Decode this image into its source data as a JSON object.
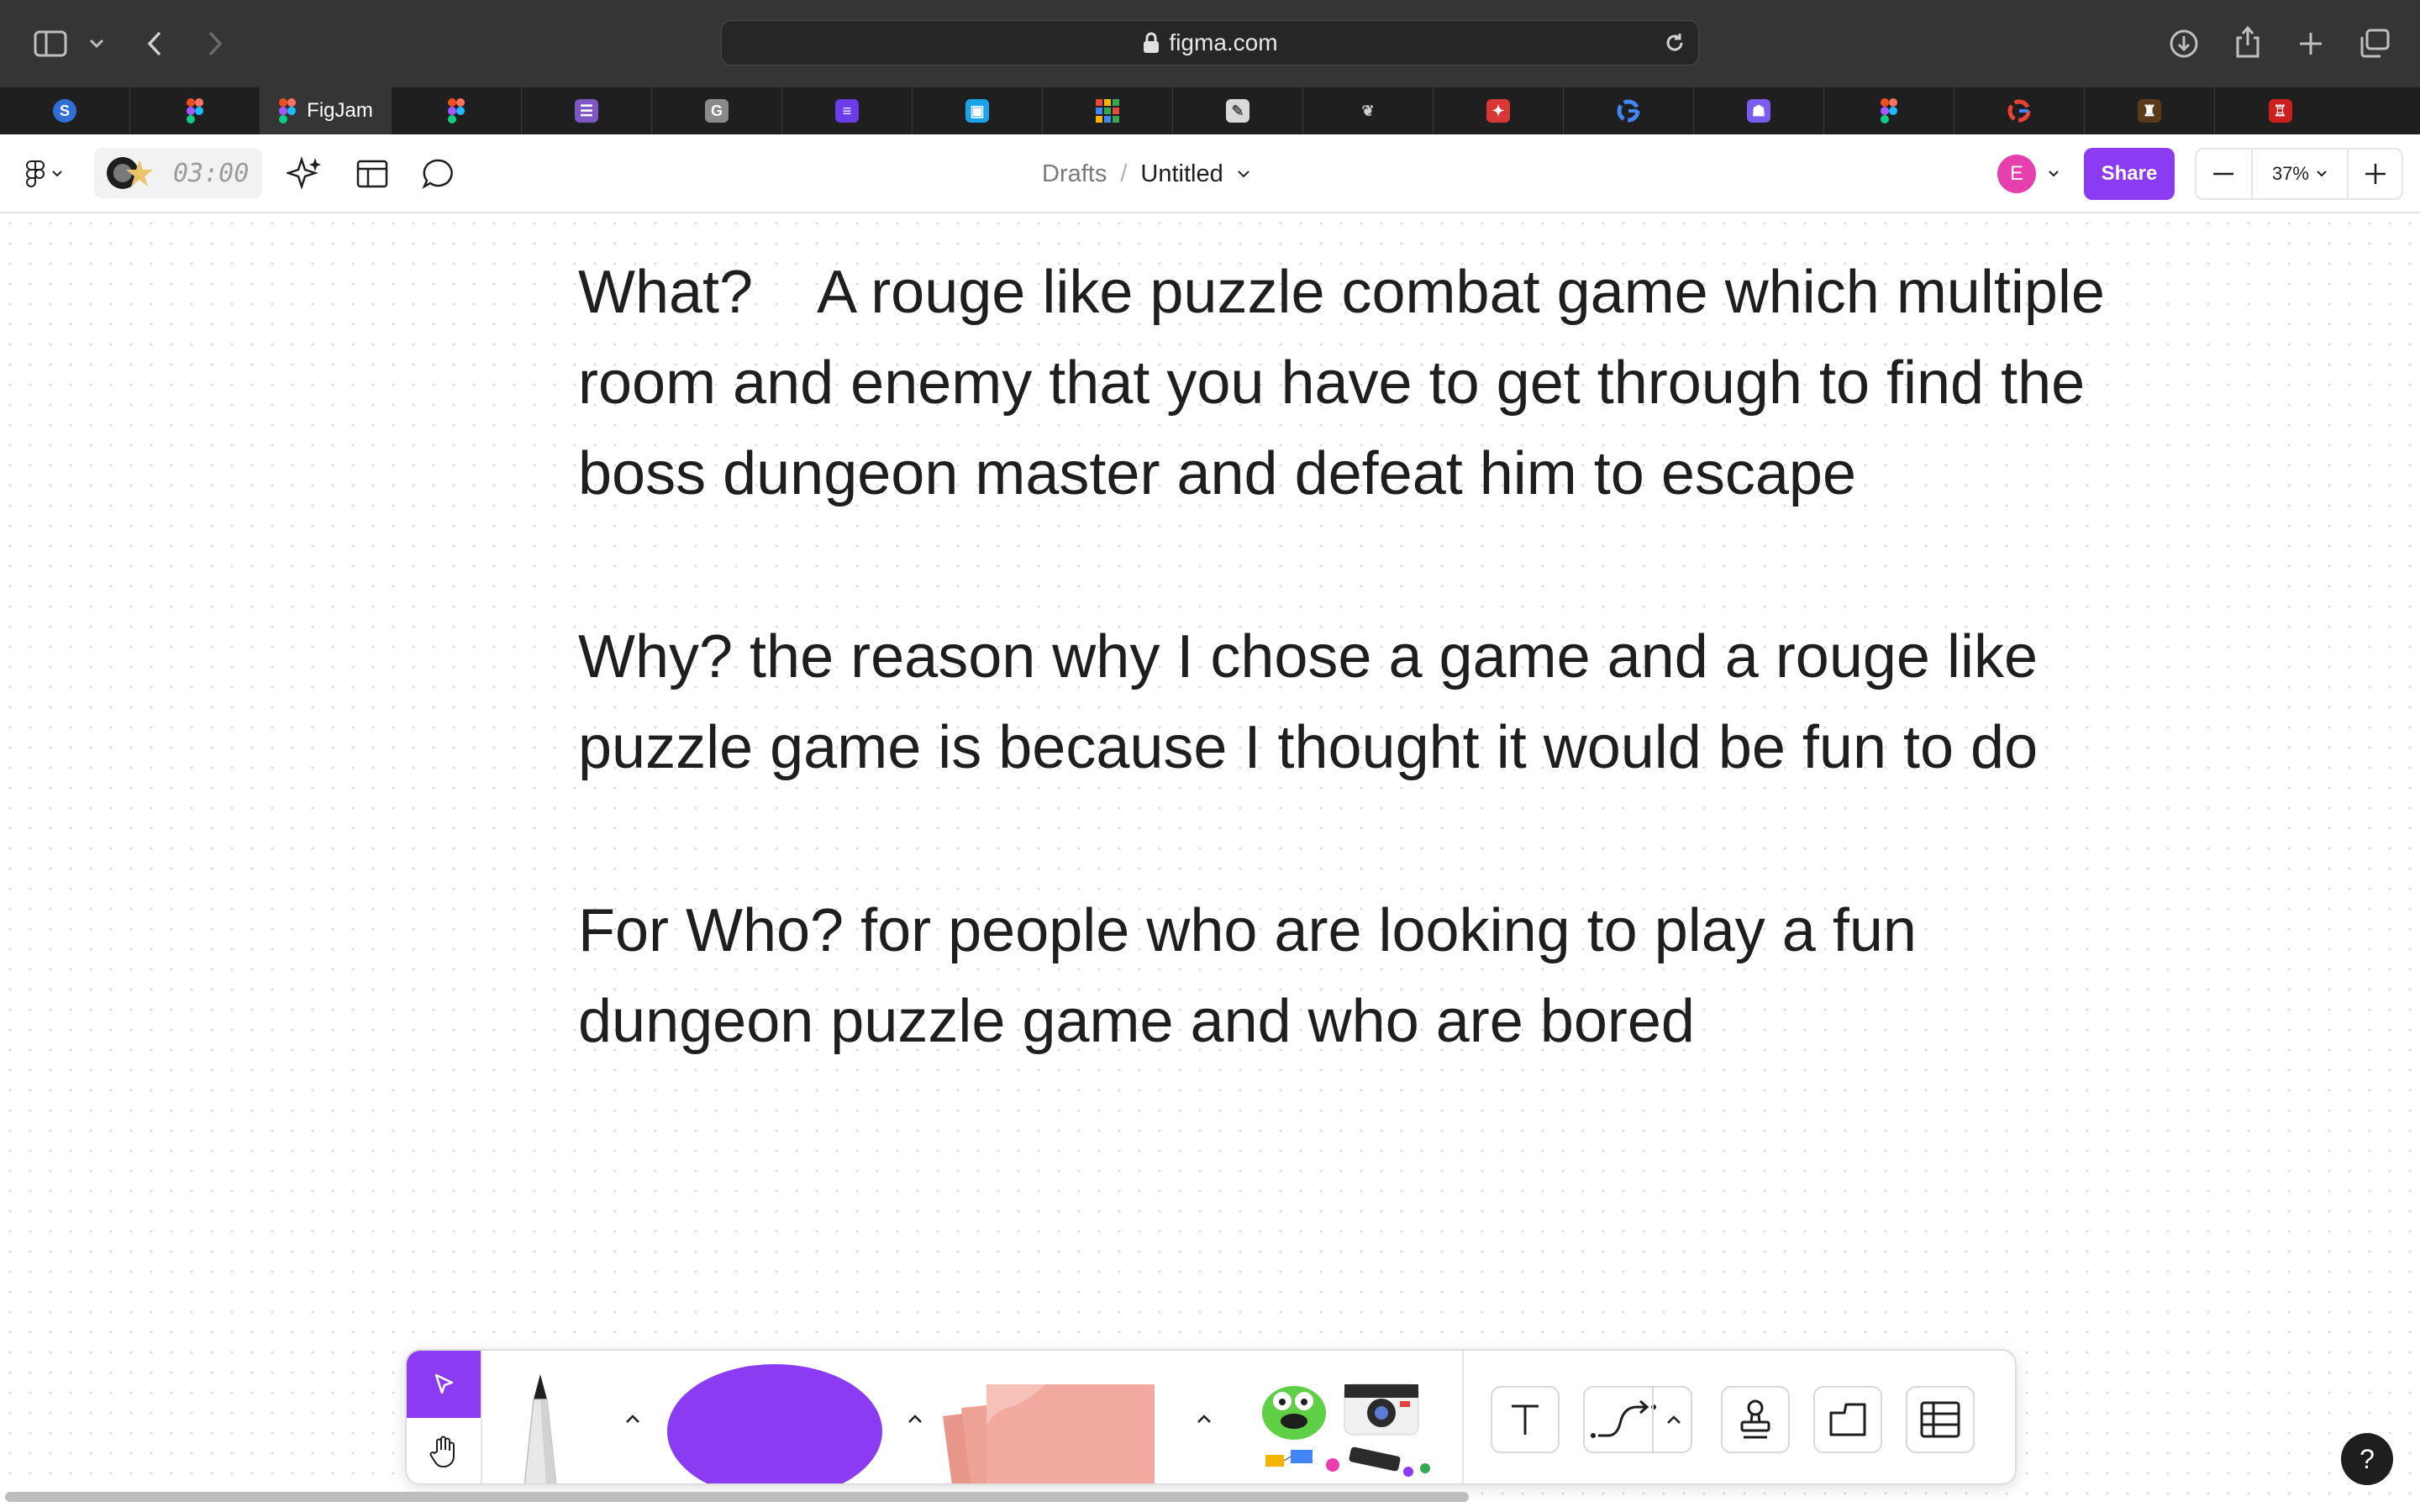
{
  "browser": {
    "url": "figma.com",
    "tabs": [
      {
        "label": "",
        "icon": "s-circle-icon"
      },
      {
        "label": "",
        "icon": "figma-icon"
      },
      {
        "label": "FigJam",
        "icon": "figma-icon",
        "active": true
      },
      {
        "label": "",
        "icon": "figma-icon"
      },
      {
        "label": "",
        "icon": "google-forms-icon"
      },
      {
        "label": "",
        "icon": "g-letter-icon"
      },
      {
        "label": "",
        "icon": "list-app-icon"
      },
      {
        "label": "",
        "icon": "square-app-icon"
      },
      {
        "label": "",
        "icon": "grid-app-icon"
      },
      {
        "label": "",
        "icon": "paper-app-icon"
      },
      {
        "label": "",
        "icon": "bird-icon"
      },
      {
        "label": "",
        "icon": "red-app-icon"
      },
      {
        "label": "",
        "icon": "google-icon"
      },
      {
        "label": "",
        "icon": "ghost-app-icon"
      },
      {
        "label": "",
        "icon": "figma-icon"
      },
      {
        "label": "",
        "icon": "google-icon"
      },
      {
        "label": "",
        "icon": "game-icon"
      },
      {
        "label": "",
        "icon": "red-robot-icon"
      }
    ]
  },
  "toolbar": {
    "timer": "03:00",
    "breadcrumb_parent": "Drafts",
    "breadcrumb_sep": "/",
    "file_name": "Untitled",
    "avatar_initial": "E",
    "share_label": "Share",
    "zoom": "37%"
  },
  "board": {
    "what": "What?    A rouge like puzzle combat game which multiple room and enemy that you have to get through to find the boss dungeon master and defeat him to escape",
    "why": "Why? the reason why I chose a game and a rouge like puzzle game is because I thought it would be fun to do",
    "for_who": "For Who? for people who are looking to play a fun dungeon puzzle game and who are bored"
  },
  "help": "?",
  "colors": {
    "accent": "#8b3cf3",
    "avatar": "#e63fae",
    "sticky": "#f2aaa0"
  }
}
